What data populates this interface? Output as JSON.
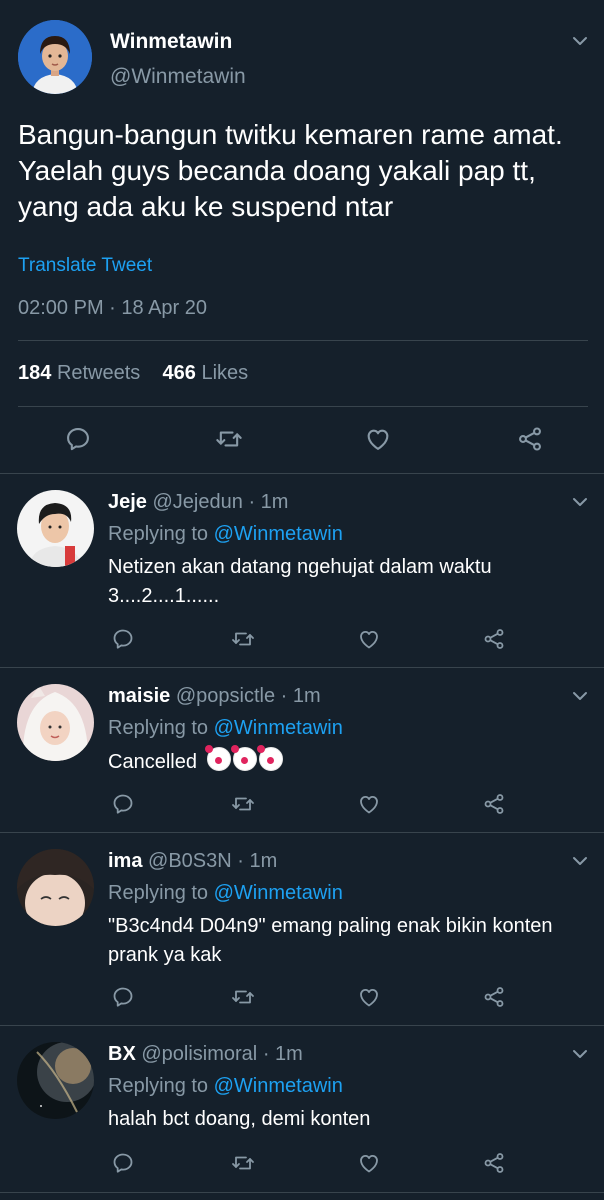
{
  "main_tweet": {
    "display_name": "Winmetawin",
    "handle": "@Winmetawin",
    "text": "Bangun-bangun twitku kemaren rame amat. Yaelah guys becanda doang yakali pap tt, yang ada aku ke suspend ntar",
    "translate_label": "Translate Tweet",
    "timestamp": "02:00 PM · 18 Apr 20",
    "retweets_count": "184",
    "retweets_label": "Retweets",
    "likes_count": "466",
    "likes_label": "Likes"
  },
  "replies": [
    {
      "name": "Jeje",
      "handle": "@Jejedun",
      "time": "· 1m",
      "replying_prefix": "Replying to",
      "replying_to": "@Winmetawin",
      "text": "Netizen akan datang ngehujat dalam waktu 3....2....1......"
    },
    {
      "name": "maisie",
      "handle": "@popsictle",
      "time": "· 1m",
      "replying_prefix": "Replying to",
      "replying_to": "@Winmetawin",
      "text": "Cancelled"
    },
    {
      "name": "ima",
      "handle": "@B0S3N",
      "time": "· 1m",
      "replying_prefix": "Replying to",
      "replying_to": "@Winmetawin",
      "text": "\"B3c4nd4 D04n9\" emang paling enak bikin konten prank ya kak"
    },
    {
      "name": "BX",
      "handle": "@polisimoral",
      "time": "· 1m",
      "replying_prefix": "Replying to",
      "replying_to": "@Winmetawin",
      "text": "halah bct doang, demi konten"
    }
  ],
  "icons": {
    "reply": "reply-icon",
    "retweet": "retweet-icon",
    "like": "like-icon",
    "share": "share-icon",
    "more": "chevron-down-icon",
    "emoji": "clown-face-emoji"
  },
  "colors": {
    "background": "#15202b",
    "link": "#1da1f2",
    "muted": "#8899a6",
    "divider": "#38444d"
  }
}
